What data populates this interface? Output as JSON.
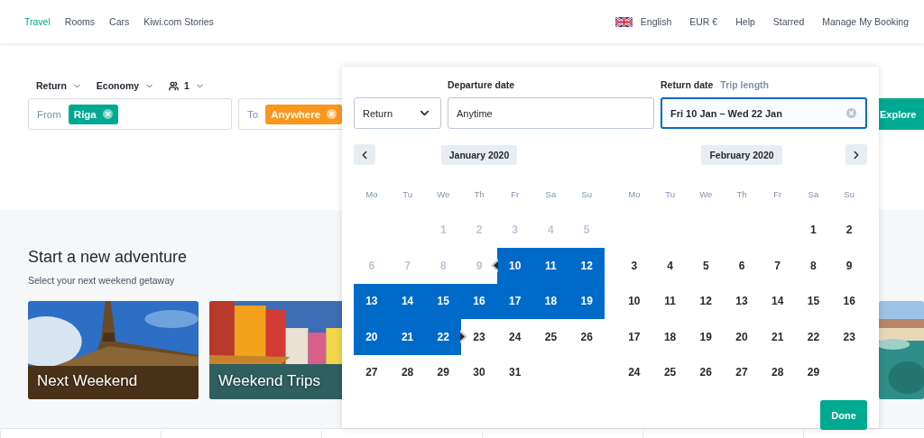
{
  "header": {
    "nav": [
      {
        "label": "Travel",
        "selected": true
      },
      {
        "label": "Rooms",
        "selected": false
      },
      {
        "label": "Cars",
        "selected": false
      },
      {
        "label": "Kiwi.com Stories",
        "selected": false
      }
    ],
    "language": "English",
    "currency": "EUR €",
    "links": [
      "Help",
      "Starred",
      "Manage My Booking"
    ]
  },
  "search": {
    "options": [
      {
        "kind": "dropdown",
        "label": "Return"
      },
      {
        "kind": "dropdown",
        "label": "Economy"
      },
      {
        "kind": "passengers",
        "label": "1"
      }
    ],
    "from": {
      "label": "From",
      "chip": "Riga"
    },
    "to": {
      "label": "To",
      "chip": "Anywhere"
    },
    "explore": "Explore"
  },
  "adventure": {
    "title": "Start a new adventure",
    "subtitle": "Select your next weekend getaway",
    "cards": [
      {
        "label": "Next Weekend",
        "kind": "picture"
      },
      {
        "label": "Weekend Trips",
        "kind": "picture"
      }
    ]
  },
  "date_picker": {
    "trip_type": "Return",
    "departure": {
      "label": "Departure date",
      "value": "Anytime"
    },
    "return": {
      "label": "Return date",
      "alt_label": "Trip length",
      "value": "Fri 10 Jan – Wed 22 Jan",
      "focused": true
    },
    "months": [
      {
        "title": "January 2020",
        "weekdays": [
          "Mo",
          "Tu",
          "We",
          "Th",
          "Fr",
          "Sa",
          "Su"
        ],
        "weeks": [
          [
            {
              "label": "1",
              "selected": false,
              "disabled": true
            },
            {
              "label": "2",
              "selected": false,
              "disabled": true
            },
            {
              "label": "3",
              "selected": false,
              "disabled": true
            },
            {
              "label": "4",
              "selected": false,
              "disabled": true
            },
            {
              "label": "5",
              "selected": false,
              "disabled": true
            }
          ],
          [
            {
              "label": "6",
              "selected": false,
              "disabled": true
            },
            {
              "label": "7",
              "selected": false,
              "disabled": true
            },
            {
              "label": "8",
              "selected": false,
              "disabled": true
            },
            {
              "label": "9",
              "selected": false,
              "disabled": true
            },
            {
              "label": "10",
              "selected": true,
              "disabled": false
            },
            {
              "label": "11",
              "selected": true,
              "disabled": false
            },
            {
              "label": "12",
              "selected": true,
              "disabled": false
            }
          ],
          [
            {
              "label": "13",
              "selected": true,
              "disabled": false
            },
            {
              "label": "14",
              "selected": true,
              "disabled": false
            },
            {
              "label": "15",
              "selected": true,
              "disabled": false
            },
            {
              "label": "16",
              "selected": true,
              "disabled": false
            },
            {
              "label": "17",
              "selected": true,
              "disabled": false
            },
            {
              "label": "18",
              "selected": true,
              "disabled": false
            },
            {
              "label": "19",
              "selected": true,
              "disabled": false
            }
          ],
          [
            {
              "label": "20",
              "selected": true,
              "disabled": false
            },
            {
              "label": "21",
              "selected": true,
              "disabled": false
            },
            {
              "label": "22",
              "selected": true,
              "disabled": false
            },
            {
              "label": "23",
              "selected": false,
              "disabled": false
            },
            {
              "label": "24",
              "selected": false,
              "disabled": false
            },
            {
              "label": "25",
              "selected": false,
              "disabled": false
            },
            {
              "label": "26",
              "selected": false,
              "disabled": false
            }
          ],
          [
            {
              "label": "27",
              "selected": false,
              "disabled": false
            },
            {
              "label": "28",
              "selected": false,
              "disabled": false
            },
            {
              "label": "29",
              "selected": false,
              "disabled": false
            },
            {
              "label": "30",
              "selected": false,
              "disabled": false
            },
            {
              "label": "31",
              "selected": false,
              "disabled": false
            }
          ]
        ]
      },
      {
        "title": "February 2020",
        "weekdays": [
          "Mo",
          "Tu",
          "We",
          "Th",
          "Fr",
          "Sa",
          "Su"
        ],
        "weeks": [
          [
            {
              "label": "1",
              "selected": false,
              "disabled": false
            },
            {
              "label": "2",
              "selected": false,
              "disabled": false
            }
          ],
          [
            {
              "label": "3",
              "selected": false,
              "disabled": false
            },
            {
              "label": "4",
              "selected": false,
              "disabled": false
            },
            {
              "label": "5",
              "selected": false,
              "disabled": false
            },
            {
              "label": "6",
              "selected": false,
              "disabled": false
            },
            {
              "label": "7",
              "selected": false,
              "disabled": false
            },
            {
              "label": "8",
              "selected": false,
              "disabled": false
            },
            {
              "label": "9",
              "selected": false,
              "disabled": false
            }
          ],
          [
            {
              "label": "10",
              "selected": false,
              "disabled": false
            },
            {
              "label": "11",
              "selected": false,
              "disabled": false
            },
            {
              "label": "12",
              "selected": false,
              "disabled": false
            },
            {
              "label": "13",
              "selected": false,
              "disabled": false
            },
            {
              "label": "14",
              "selected": false,
              "disabled": false
            },
            {
              "label": "15",
              "selected": false,
              "disabled": false
            },
            {
              "label": "16",
              "selected": false,
              "disabled": false
            }
          ],
          [
            {
              "label": "17",
              "selected": false,
              "disabled": false
            },
            {
              "label": "18",
              "selected": false,
              "disabled": false
            },
            {
              "label": "19",
              "selected": false,
              "disabled": false
            },
            {
              "label": "20",
              "selected": false,
              "disabled": false
            },
            {
              "label": "21",
              "selected": false,
              "disabled": false
            },
            {
              "label": "22",
              "selected": false,
              "disabled": false
            },
            {
              "label": "23",
              "selected": false,
              "disabled": false
            }
          ],
          [
            {
              "label": "24",
              "selected": false,
              "disabled": false
            },
            {
              "label": "25",
              "selected": false,
              "disabled": false
            },
            {
              "label": "26",
              "selected": false,
              "disabled": false
            },
            {
              "label": "27",
              "selected": false,
              "disabled": false
            },
            {
              "label": "28",
              "selected": false,
              "disabled": false
            },
            {
              "label": "29",
              "selected": false,
              "disabled": false
            }
          ]
        ]
      }
    ],
    "done": "Done"
  }
}
